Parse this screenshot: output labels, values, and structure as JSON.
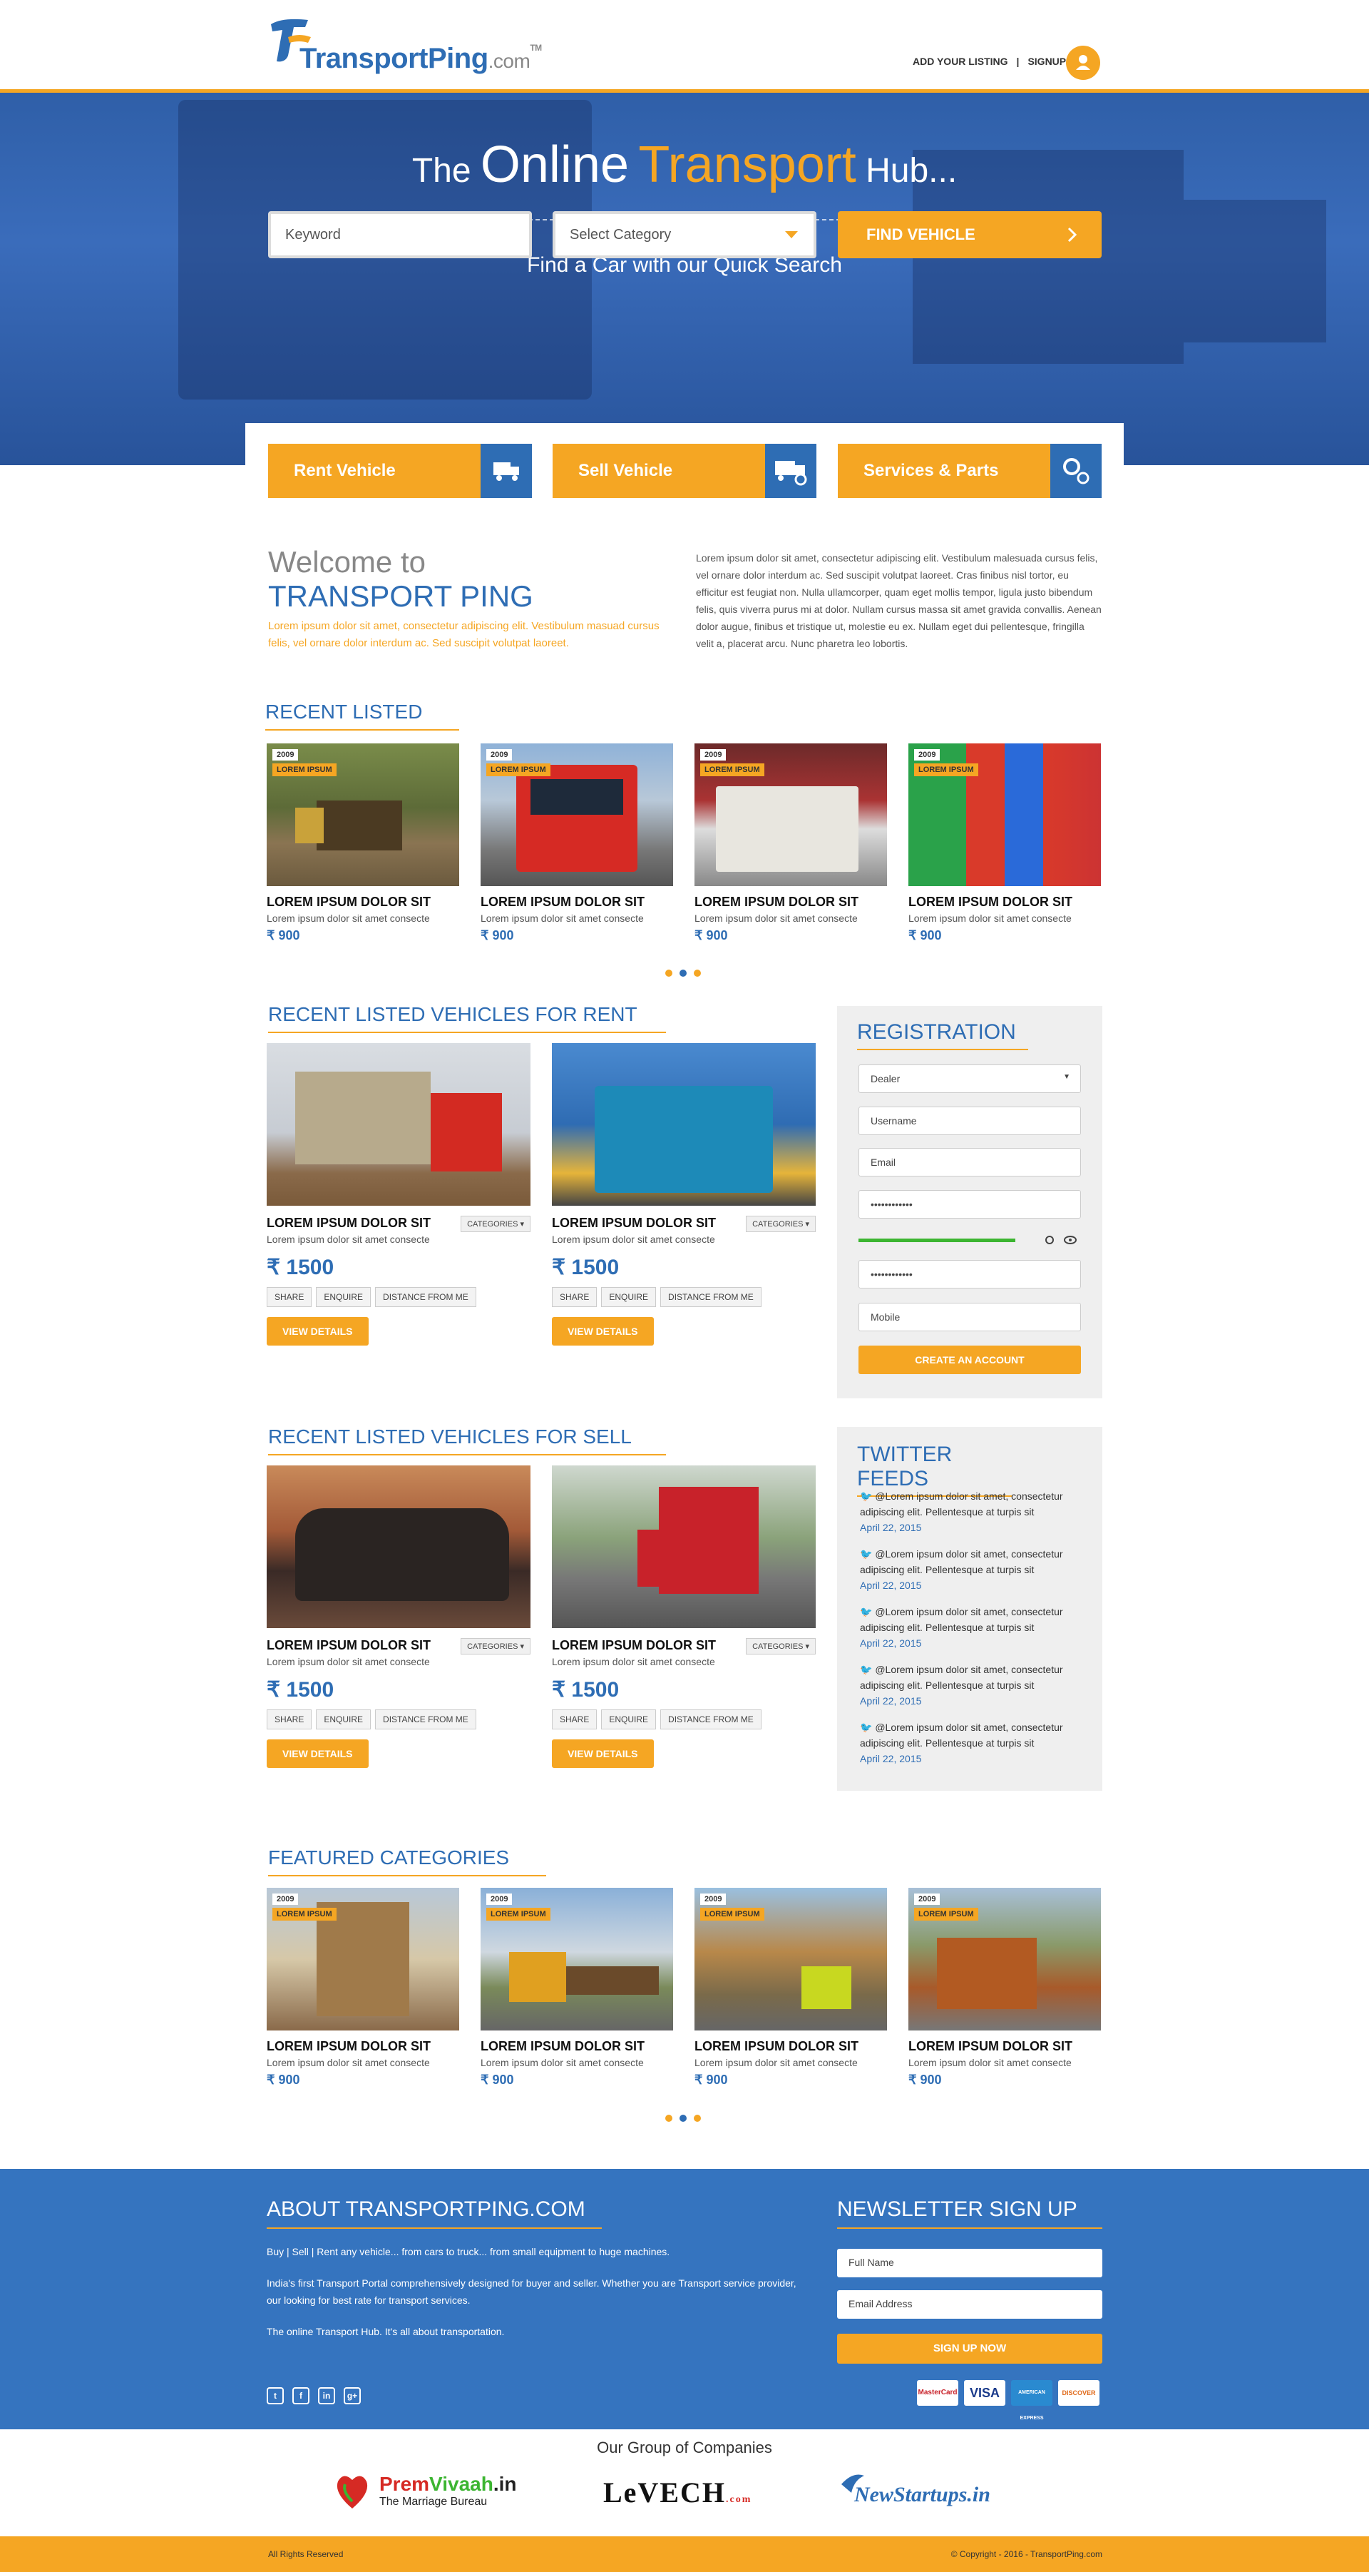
{
  "brand": {
    "name": "TransportPing",
    "suffix": ".com",
    "tm": "TM"
  },
  "top_links": {
    "add_listing": "ADD YOUR LISTING",
    "sep": "|",
    "signup": "SIGNUP"
  },
  "hero": {
    "the": "The",
    "online": "Online",
    "transport": "Transport",
    "hub": "Hub...",
    "subtitle": "Find a Car with our Quick Search",
    "keyword_placeholder": "Keyword",
    "category_placeholder": "Select Category",
    "find_button": "FIND VEHICLE"
  },
  "services": [
    {
      "label": "Rent Vehicle"
    },
    {
      "label": "Sell Vehicle"
    },
    {
      "label": "Services & Parts"
    }
  ],
  "welcome": {
    "line1": "Welcome to",
    "line2": "TRANSPORT PING",
    "tagline": "Lorem ipsum dolor sit amet, consectetur adipiscing elit. Vestibulum masuad cursus felis, vel ornare dolor interdum ac. Sed suscipit volutpat laoreet.",
    "body": "Lorem ipsum dolor sit amet, consectetur adipiscing elit. Vestibulum malesuada cursus felis, vel ornare dolor interdum ac. Sed suscipit volutpat laoreet. Cras finibus nisl tortor, eu efficitur est feugiat non. Nulla ullamcorper, quam eget mollis tempor, ligula justo bibendum felis, quis viverra purus mi at dolor. Nullam cursus massa sit amet gravida convallis. Aenean dolor augue, finibus et tristique ut, molestie eu ex. Nullam eget dui pellentesque, fringilla velit a, placerat arcu. Nunc pharetra leo lobortis."
  },
  "recent": {
    "title": "RECENT LISTED",
    "items": [
      {
        "year": "2009",
        "tag": "LOREM IPSUM",
        "title": "LOREM IPSUM DOLOR SIT",
        "sub": "Lorem ipsum dolor sit amet consecte",
        "price": "₹ 900"
      },
      {
        "year": "2009",
        "tag": "LOREM IPSUM",
        "title": "LOREM IPSUM DOLOR SIT",
        "sub": "Lorem ipsum dolor sit amet consecte",
        "price": "₹ 900"
      },
      {
        "year": "2009",
        "tag": "LOREM IPSUM",
        "title": "LOREM IPSUM DOLOR SIT",
        "sub": "Lorem ipsum dolor sit amet consecte",
        "price": "₹ 900"
      },
      {
        "year": "2009",
        "tag": "LOREM IPSUM",
        "title": "LOREM IPSUM DOLOR SIT",
        "sub": "Lorem ipsum dolor sit amet consecte",
        "price": "₹ 900"
      }
    ]
  },
  "rent": {
    "title": "RECENT LISTED VEHICLES FOR RENT",
    "items": [
      {
        "title": "LOREM IPSUM DOLOR SIT",
        "sub": "Lorem ipsum dolor sit amet consecte",
        "categories": "CATEGORIES",
        "price": "₹ 1500",
        "share": "SHARE",
        "enquire": "ENQUIRE",
        "distance": "DISTANCE FROM ME",
        "view": "VIEW DETAILS"
      },
      {
        "title": "LOREM IPSUM DOLOR SIT",
        "sub": "Lorem ipsum dolor sit amet consecte",
        "categories": "CATEGORIES",
        "price": "₹ 1500",
        "share": "SHARE",
        "enquire": "ENQUIRE",
        "distance": "DISTANCE FROM ME",
        "view": "VIEW DETAILS"
      }
    ]
  },
  "sell": {
    "title": "RECENT LISTED VEHICLES FOR SELL",
    "items": [
      {
        "title": "LOREM IPSUM DOLOR SIT",
        "sub": "Lorem ipsum dolor sit amet consecte",
        "categories": "CATEGORIES",
        "price": "₹ 1500",
        "share": "SHARE",
        "enquire": "ENQUIRE",
        "distance": "DISTANCE FROM ME",
        "view": "VIEW DETAILS"
      },
      {
        "title": "LOREM IPSUM DOLOR SIT",
        "sub": "Lorem ipsum dolor sit amet consecte",
        "categories": "CATEGORIES",
        "price": "₹ 1500",
        "share": "SHARE",
        "enquire": "ENQUIRE",
        "distance": "DISTANCE FROM ME",
        "view": "VIEW DETAILS"
      }
    ]
  },
  "registration": {
    "title": "REGISTRATION",
    "type": "Dealer",
    "username": "Username",
    "email": "Email",
    "password": "••••••••••••",
    "confirm": "••••••••••••",
    "mobile": "Mobile",
    "button": "CREATE AN ACCOUNT"
  },
  "twitter": {
    "title": "TWITTER FEEDS",
    "items": [
      {
        "text": "@Lorem ipsum dolor sit amet, consectetur adipiscing elit. Pellentesque at turpis sit",
        "date": "April 22, 2015"
      },
      {
        "text": "@Lorem ipsum dolor sit amet, consectetur adipiscing elit. Pellentesque at turpis sit",
        "date": "April 22, 2015"
      },
      {
        "text": "@Lorem ipsum dolor sit amet, consectetur adipiscing elit. Pellentesque at turpis sit",
        "date": "April 22, 2015"
      },
      {
        "text": "@Lorem ipsum dolor sit amet, consectetur adipiscing elit. Pellentesque at turpis sit",
        "date": "April 22, 2015"
      },
      {
        "text": "@Lorem ipsum dolor sit amet, consectetur adipiscing elit. Pellentesque at turpis sit",
        "date": "April 22, 2015"
      }
    ]
  },
  "featured": {
    "title": "FEATURED CATEGORIES",
    "items": [
      {
        "year": "2009",
        "tag": "LOREM IPSUM",
        "title": "LOREM IPSUM DOLOR SIT",
        "sub": "Lorem ipsum dolor sit amet consecte",
        "price": "₹ 900"
      },
      {
        "year": "2009",
        "tag": "LOREM IPSUM",
        "title": "LOREM IPSUM DOLOR SIT",
        "sub": "Lorem ipsum dolor sit amet consecte",
        "price": "₹ 900"
      },
      {
        "year": "2009",
        "tag": "LOREM IPSUM",
        "title": "LOREM IPSUM DOLOR SIT",
        "sub": "Lorem ipsum dolor sit amet consecte",
        "price": "₹ 900"
      },
      {
        "year": "2009",
        "tag": "LOREM IPSUM",
        "title": "LOREM IPSUM DOLOR SIT",
        "sub": "Lorem ipsum dolor sit amet consecte",
        "price": "₹ 900"
      }
    ]
  },
  "about": {
    "title": "ABOUT TRANSPORTPING.COM",
    "p1": "Buy | Sell | Rent any vehicle... from cars to truck...  from small equipment to huge machines.",
    "p2": "India's first Transport Portal comprehensively designed for buyer and seller. Whether you are Transport service provider, our looking for best rate for transport services.",
    "p3": "The online Transport Hub. It's all about transportation."
  },
  "newsletter": {
    "title": "NEWSLETTER SIGN UP",
    "name": "Full Name",
    "email": "Email  Address",
    "button": "SIGN UP NOW"
  },
  "payments": [
    "MasterCard",
    "VISA",
    "AMERICAN EXPRESS",
    "DISCOVER"
  ],
  "group": {
    "title": "Our Group of Companies",
    "c1a": "Prem",
    "c1b": "Vivaah",
    "c1c": ".in",
    "c1tag": "The Marriage Bureau",
    "c2": "LeVECH",
    "c2tag": ".com",
    "c3": "NewStartups.in"
  },
  "bottom": {
    "left": "All Rights Reserved",
    "right": "© Copyright - 2016 - TransportPing.com"
  },
  "colors": {
    "orange": "#f5a623",
    "blue": "#2e6db4",
    "footer": "#3574bf"
  },
  "icons": [
    "user-icon",
    "chevron-right-icon",
    "caret-down-icon",
    "truck-rent-icon",
    "truck-sell-icon",
    "gears-icon",
    "twitter-icon",
    "facebook-icon",
    "linkedin-icon",
    "googleplus-icon",
    "refresh-icon",
    "eye-icon"
  ]
}
